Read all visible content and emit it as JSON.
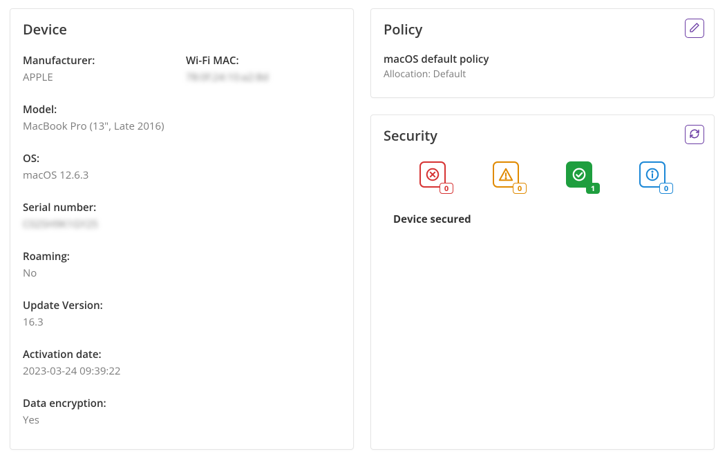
{
  "device": {
    "title": "Device",
    "fields": {
      "manufacturer": {
        "label": "Manufacturer:",
        "value": "APPLE"
      },
      "wifi_mac": {
        "label": "Wi-Fi MAC:",
        "value": "78:0f:24:10:a2:8d"
      },
      "model": {
        "label": "Model:",
        "value": "MacBook Pro (13\", Late 2016)"
      },
      "os": {
        "label": "OS:",
        "value": "macOS 12.6.3"
      },
      "serial": {
        "label": "Serial number:",
        "value": "C02SH9K1GY25"
      },
      "roaming": {
        "label": "Roaming:",
        "value": "No"
      },
      "update": {
        "label": "Update Version:",
        "value": "16.3"
      },
      "activation": {
        "label": "Activation date:",
        "value": "2023-03-24 09:39:22"
      },
      "encryption": {
        "label": "Data encryption:",
        "value": "Yes"
      }
    }
  },
  "policy": {
    "title": "Policy",
    "name": "macOS default policy",
    "allocation_label": "Allocation: Default"
  },
  "security": {
    "title": "Security",
    "status_text": "Device secured",
    "counts": {
      "error": "0",
      "warning": "0",
      "ok": "1",
      "info": "0"
    }
  }
}
